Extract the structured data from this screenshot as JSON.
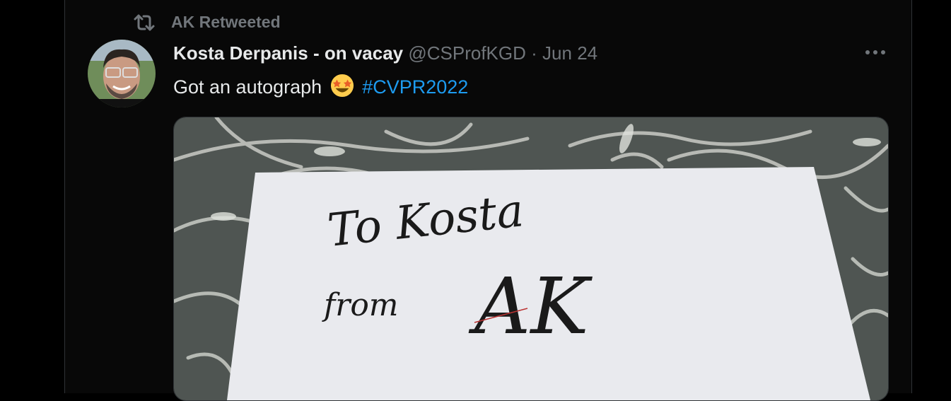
{
  "retweet": {
    "label": "AK Retweeted",
    "icon": "retweet-icon"
  },
  "tweet": {
    "author_name": "Kosta Derpanis - on vacay",
    "handle": "@CSProfKGD",
    "separator": "·",
    "date": "Jun 24",
    "text": "Got an autograph",
    "emoji": "star-struck",
    "hashtag": "#CVPR2022",
    "more_icon": "more-icon"
  },
  "media": {
    "handwriting": [
      "To Kosta",
      "from",
      "AK"
    ]
  },
  "colors": {
    "accent": "#1d9bf0",
    "muted": "#71767b",
    "text": "#e7e9ea",
    "background": "#080808"
  }
}
